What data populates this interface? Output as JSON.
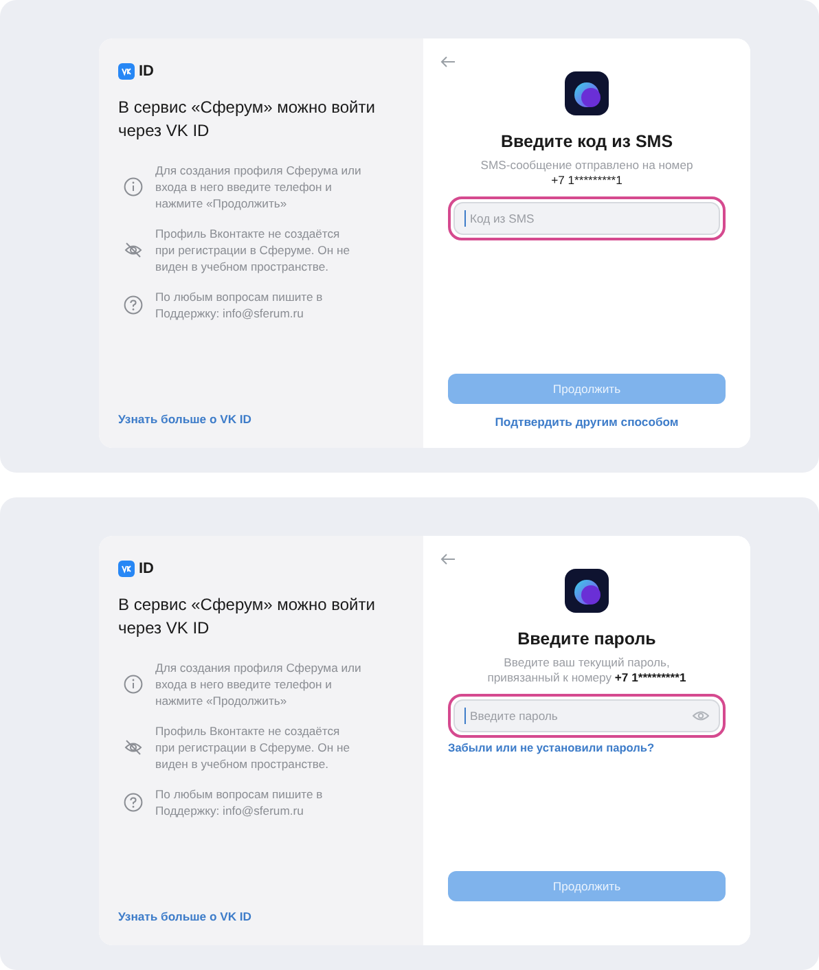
{
  "screens": [
    {
      "left": {
        "logo_text": "ID",
        "heading": "В сервис «Сферум» можно войти через VK ID",
        "notes": [
          {
            "kind": "info",
            "text": "Для создания профиля Сферума или входа в него введите телефон и нажмите «Продолжить»"
          },
          {
            "kind": "hidden",
            "text": "Профиль Вконтакте не создаётся при регистрации в Сферуме. Он не виден в учебном пространстве."
          },
          {
            "kind": "help",
            "text": "По любым вопросам пишите в Поддержку: info@sferum.ru"
          }
        ],
        "link": "Узнать больше о VK ID"
      },
      "right": {
        "title": "Введите код из SMS",
        "subtitle": "SMS-сообщение отправлено на номер",
        "phone": "+7 1*********1",
        "phone_on_own_line": true,
        "field": {
          "kind": "code",
          "placeholder": "Код из SMS",
          "focused": true
        },
        "button": "Продолжить",
        "alt_link": "Подтвердить другим способом"
      }
    },
    {
      "left": {
        "logo_text": "ID",
        "heading": "В сервис «Сферум» можно войти через VK ID",
        "notes": [
          {
            "kind": "info",
            "text": "Для создания профиля Сферума или входа в него введите телефон и нажмите «Продолжить»"
          },
          {
            "kind": "hidden",
            "text": "Профиль Вконтакте не создаётся при регистрации в Сферуме. Он не виден в учебном пространстве."
          },
          {
            "kind": "help",
            "text": "По любым вопросам пишите в Поддержку: info@sferum.ru"
          }
        ],
        "link": "Узнать больше о VK ID"
      },
      "right": {
        "title": "Введите пароль",
        "subtitle": "Введите ваш текущий пароль, привязанный к номеру",
        "phone": "+7 1*********1",
        "phone_on_own_line": false,
        "field": {
          "kind": "password",
          "placeholder": "Введите пароль",
          "focused": true
        },
        "forgot_link": "Забыли или не установили пароль?",
        "button": "Продолжить"
      }
    }
  ]
}
